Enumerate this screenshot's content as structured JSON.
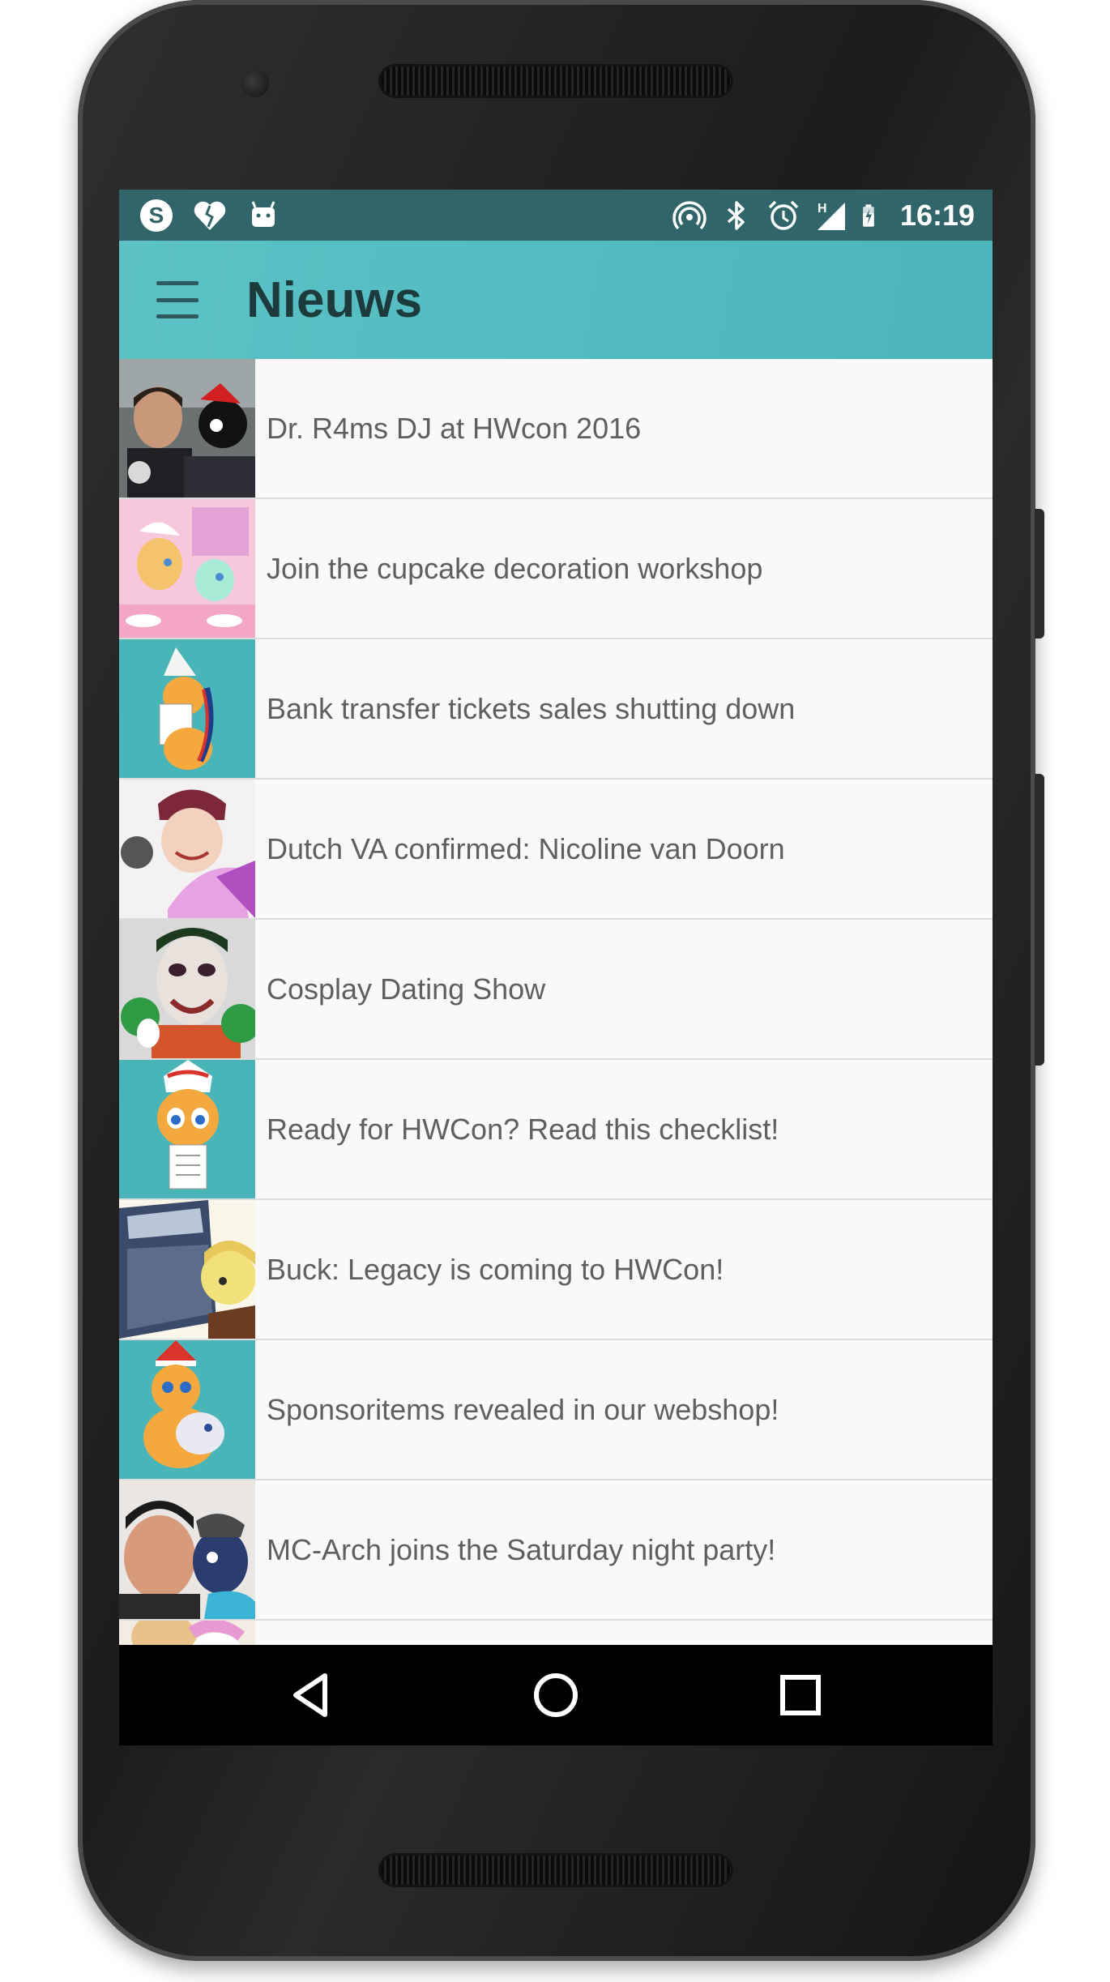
{
  "status_bar": {
    "left_icons": [
      "skype-icon",
      "broken-heart-icon",
      "android-icon"
    ],
    "right_icons": [
      "hotspot-icon",
      "bluetooth-icon",
      "alarm-icon",
      "signal-h-icon",
      "battery-charging-icon"
    ],
    "network_type": "H",
    "time": "16:19"
  },
  "app_bar": {
    "menu_icon": "hamburger-menu-icon",
    "title": "Nieuws"
  },
  "news": [
    {
      "title": "Dr. R4ms DJ at HWcon 2016",
      "thumb": "dj-photo"
    },
    {
      "title": "Join the cupcake decoration workshop",
      "thumb": "cupcake-ponies"
    },
    {
      "title": "Bank transfer tickets sales shutting down",
      "thumb": "pony-ticket"
    },
    {
      "title": "Dutch VA confirmed: Nicoline van Doorn",
      "thumb": "voice-actress"
    },
    {
      "title": "Cosplay Dating Show",
      "thumb": "cosplay-joker"
    },
    {
      "title": "Ready for HWCon? Read this checklist!",
      "thumb": "pony-checklist"
    },
    {
      "title": "Buck: Legacy is coming to HWCon!",
      "thumb": "buck-legacy-book"
    },
    {
      "title": "Sponsoritems revealed in our webshop!",
      "thumb": "pony-plush"
    },
    {
      "title": "MC-Arch joins the Saturday night party!",
      "thumb": "mc-arch"
    },
    {
      "title": "",
      "thumb": "pony-partial"
    }
  ],
  "nav_bar": {
    "buttons": [
      "back-icon",
      "home-icon",
      "recents-icon"
    ]
  },
  "colors": {
    "status_bar": "#31656a",
    "app_bar": "#52bcc0",
    "title_text": "#1d3b3d",
    "list_text": "#5f5f5f",
    "divider": "#dcdcdc",
    "nav_bar": "#000000"
  }
}
